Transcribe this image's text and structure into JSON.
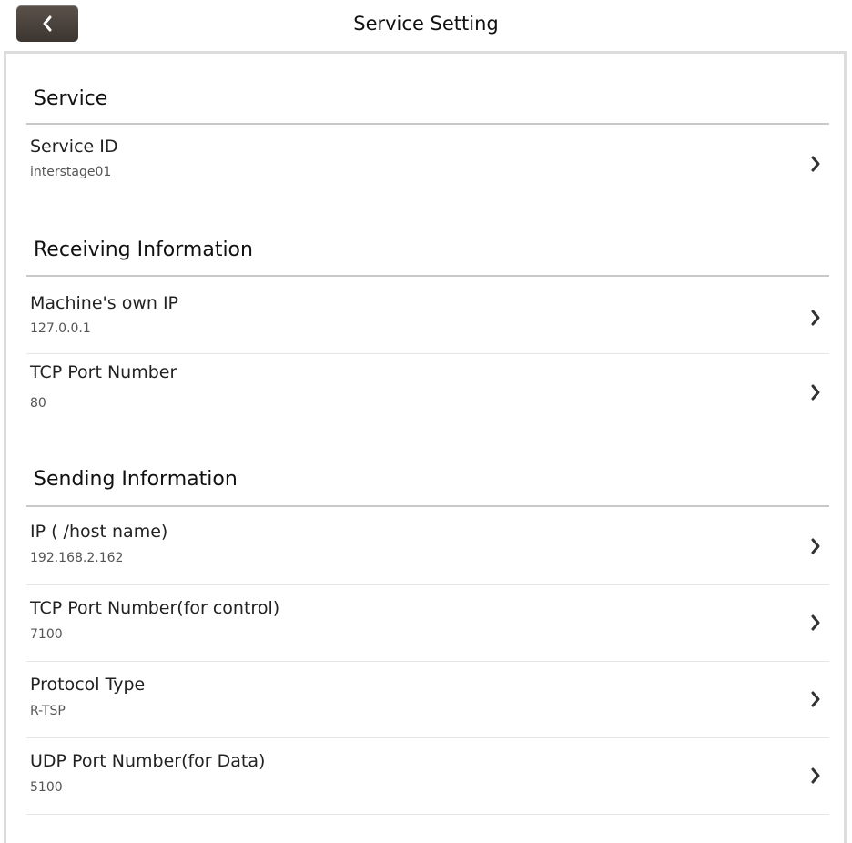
{
  "header": {
    "title": "Service Setting",
    "back_icon": "chevron-left-icon"
  },
  "sections": [
    {
      "title": "Service",
      "items": [
        {
          "label": "Service ID",
          "value": "interstage01"
        }
      ]
    },
    {
      "title": "Receiving Information",
      "items": [
        {
          "label": "Machine's own IP",
          "value": "127.0.0.1"
        },
        {
          "label": "TCP Port Number",
          "value": "80"
        }
      ]
    },
    {
      "title": "Sending Information",
      "items": [
        {
          "label": "IP ( /host name)",
          "value": "192.168.2.162"
        },
        {
          "label": "TCP Port Number(for control)",
          "value": "7100"
        },
        {
          "label": "Protocol Type",
          "value": "R-TSP"
        },
        {
          "label": "UDP Port Number(for Data)",
          "value": "5100"
        }
      ]
    }
  ],
  "colors": {
    "back_button": "#4a423c",
    "divider": "#c9c9c9",
    "panel_border": "#dcdcdc"
  }
}
